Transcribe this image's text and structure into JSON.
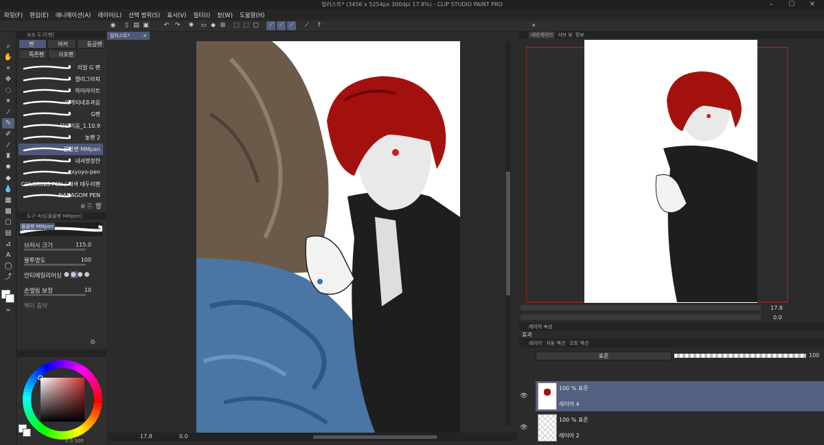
{
  "window": {
    "title": "일러스트* (3456 x 5254px 300dpi 17.8%) - CLIP STUDIO PAINT PRO"
  },
  "menu": [
    "파일(F)",
    "편집(E)",
    "애니메이션(A)",
    "레이어(L)",
    "선택 범위(S)",
    "표시(V)",
    "필터(I)",
    "창(W)",
    "도움말(H)"
  ],
  "subtool": {
    "header": "보조 도구[펜]",
    "tabs": [
      "펜",
      "마커",
      "동글펜",
      "특존펜",
      "사포펜"
    ],
    "brushes": [
      "리얼 G 펜",
      "캘리그라피",
      "하이라이트",
      "이게되네호과음",
      "G펜",
      "부드러움_1.10.9",
      "놓펜 2",
      "몰몰펜 MMpen",
      "내셔명정한",
      "piyoyo-pen",
      "COLORING PEN / 채색 테두리펜",
      "NANAGOM PEN"
    ],
    "selected_index": 7
  },
  "toolprop": {
    "header": "도구 속성[몰몰펜 MMpen]",
    "preview_name": "몰몰펜 MMpen",
    "rows": [
      {
        "label": "브러시 크기",
        "value": "115.0"
      },
      {
        "label": "불투명도",
        "value": "100"
      },
      {
        "label": "안티에일리어싱",
        "value": ""
      },
      {
        "label": "손떨림 보정",
        "value": "10"
      },
      {
        "label": "벡터 흡착",
        "value": ""
      }
    ]
  },
  "color": {
    "hue": "#cc2f2f",
    "main": "#ffffff",
    "sub": "#ffffff",
    "readout": "0 0 100"
  },
  "canvas": {
    "tab": "일러스트*",
    "zoom": "17.8",
    "angle": "0.0"
  },
  "navigator": {
    "tabs": [
      "내비게이터",
      "서브 뷰",
      "정보"
    ],
    "zoom": "17.8",
    "angle": "0.0"
  },
  "layer_prop": {
    "tab": "레이어 속성",
    "effect": "효과"
  },
  "layers": {
    "tabs": [
      "레이어",
      "자동 액션",
      "오토 액션"
    ],
    "blend_mode": "표준",
    "opacity": "100",
    "items": [
      {
        "mode": "100 % 표준",
        "name": "레이어 4",
        "selected": true
      },
      {
        "mode": "100 % 표준",
        "name": "레이어 2",
        "selected": false
      }
    ]
  },
  "accent": "#546080"
}
